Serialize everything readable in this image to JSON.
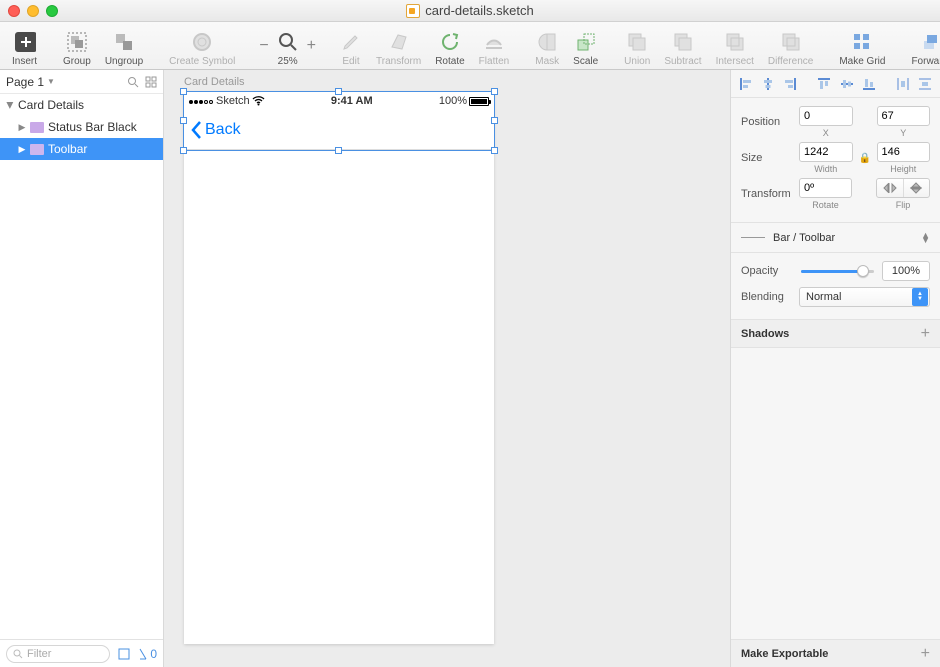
{
  "window": {
    "title": "card-details.sketch"
  },
  "toolbar": {
    "insert": "Insert",
    "group": "Group",
    "ungroup": "Ungroup",
    "create_symbol": "Create Symbol",
    "zoom": "25%",
    "edit": "Edit",
    "transform": "Transform",
    "rotate": "Rotate",
    "flatten": "Flatten",
    "mask": "Mask",
    "scale": "Scale",
    "union": "Union",
    "subtract": "Subtract",
    "intersect": "Intersect",
    "difference": "Difference",
    "make_grid": "Make Grid",
    "forward": "Forward"
  },
  "sidebar": {
    "page_label": "Page 1",
    "layers": {
      "root": "Card Details",
      "items": [
        {
          "label": "Status Bar Black"
        },
        {
          "label": "Toolbar"
        }
      ]
    },
    "filter_placeholder": "Filter",
    "slice_count": "0"
  },
  "canvas": {
    "artboard_label": "Card Details",
    "status": {
      "carrier": "Sketch",
      "time": "9:41 AM",
      "battery": "100%"
    },
    "nav": {
      "back": "Back"
    }
  },
  "inspector": {
    "position_label": "Position",
    "size_label": "Size",
    "transform_label": "Transform",
    "x": "0",
    "y": "67",
    "width": "1242",
    "height": "146",
    "rotate": "0º",
    "x_sub": "X",
    "y_sub": "Y",
    "w_sub": "Width",
    "h_sub": "Height",
    "rotate_sub": "Rotate",
    "flip_sub": "Flip",
    "style_name": "Bar / Toolbar",
    "opacity_label": "Opacity",
    "opacity_value": "100%",
    "blending_label": "Blending",
    "blending_value": "Normal",
    "shadows_label": "Shadows",
    "export_label": "Make Exportable"
  }
}
